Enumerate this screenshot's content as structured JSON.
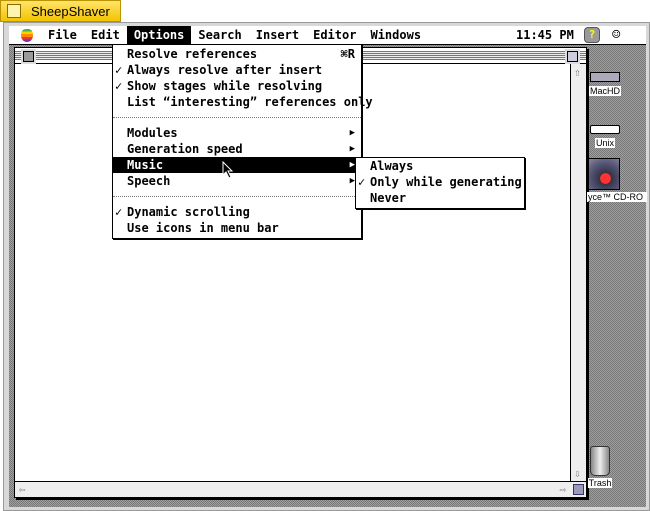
{
  "host": {
    "title": "SheepShaver"
  },
  "menubar": {
    "items": [
      "File",
      "Edit",
      "Options",
      "Search",
      "Insert",
      "Editor",
      "Windows"
    ],
    "active": "Options",
    "clock": "11:45 PM"
  },
  "options_menu": {
    "group1": [
      {
        "label": "Resolve references",
        "checked": false,
        "shortcut": "⌘R"
      },
      {
        "label": "Always resolve after insert",
        "checked": true
      },
      {
        "label": "Show stages while resolving",
        "checked": true
      },
      {
        "label": "List “interesting” references only",
        "checked": false
      }
    ],
    "group2": [
      {
        "label": "Modules"
      },
      {
        "label": "Generation speed"
      },
      {
        "label": "Music",
        "highlighted": true
      },
      {
        "label": "Speech"
      }
    ],
    "group3": [
      {
        "label": "Dynamic scrolling",
        "checked": true
      },
      {
        "label": "Use icons in menu bar",
        "checked": false
      }
    ]
  },
  "music_submenu": [
    {
      "label": "Always",
      "checked": false
    },
    {
      "label": "Only while generating",
      "checked": true
    },
    {
      "label": "Never",
      "checked": false
    }
  ],
  "desktop": {
    "icons": [
      "MacHD",
      "Unix",
      "yce™ CD-RO",
      "Trash"
    ]
  },
  "glyphs": {
    "check": "✓",
    "submenu": "▶"
  }
}
